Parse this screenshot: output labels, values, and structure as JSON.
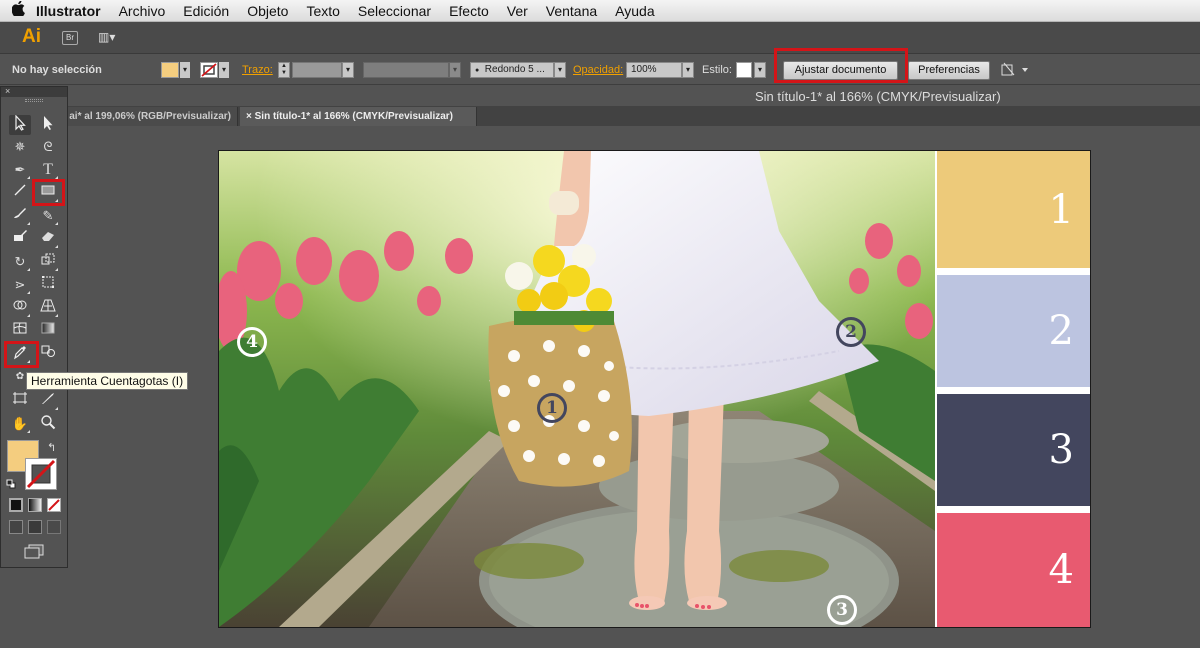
{
  "menubar": {
    "apple": "",
    "app_name": "Illustrator",
    "items": [
      "Archivo",
      "Edición",
      "Objeto",
      "Texto",
      "Seleccionar",
      "Efecto",
      "Ver",
      "Ventana",
      "Ayuda"
    ]
  },
  "appbar": {
    "logo": "Ai",
    "bridge": "Br",
    "arrange": "▥▾"
  },
  "control": {
    "selection": "No hay selección",
    "fill_color": "#f4cd7f",
    "trazo_label": "Trazo:",
    "brush": "Redondo 5 ...",
    "opacity_label": "Opacidad:",
    "opacity_value": "100%",
    "style_label": "Estilo:",
    "adjust_button": "Ajustar documento",
    "prefs_button": "Preferencias",
    "highlight_color": "#d41418"
  },
  "title_strip": "Sin título-1* al 166% (CMYK/Previsualizar)",
  "tabs": [
    {
      "label": "ai* al 199,06% (RGB/Previsualizar)"
    },
    {
      "close": "×",
      "label": "Sin título-1* al 166% (CMYK/Previsualizar)"
    }
  ],
  "toolbox": {
    "close": "×",
    "tooltip": "Herramienta Cuentagotas (I)",
    "fill_color": "#f4cd7f"
  },
  "artboard": {
    "palette": [
      {
        "number": "1",
        "color": "#edca7a"
      },
      {
        "number": "2",
        "color": "#bcc4e0"
      },
      {
        "number": "3",
        "color": "#43465e"
      },
      {
        "number": "4",
        "color": "#e85a70"
      }
    ],
    "markers": [
      {
        "number": "1",
        "color": "#43465e"
      },
      {
        "number": "2",
        "color": "#43465e"
      },
      {
        "number": "3",
        "color": "#ffffff"
      },
      {
        "number": "4",
        "color": "#ffffff"
      }
    ]
  }
}
